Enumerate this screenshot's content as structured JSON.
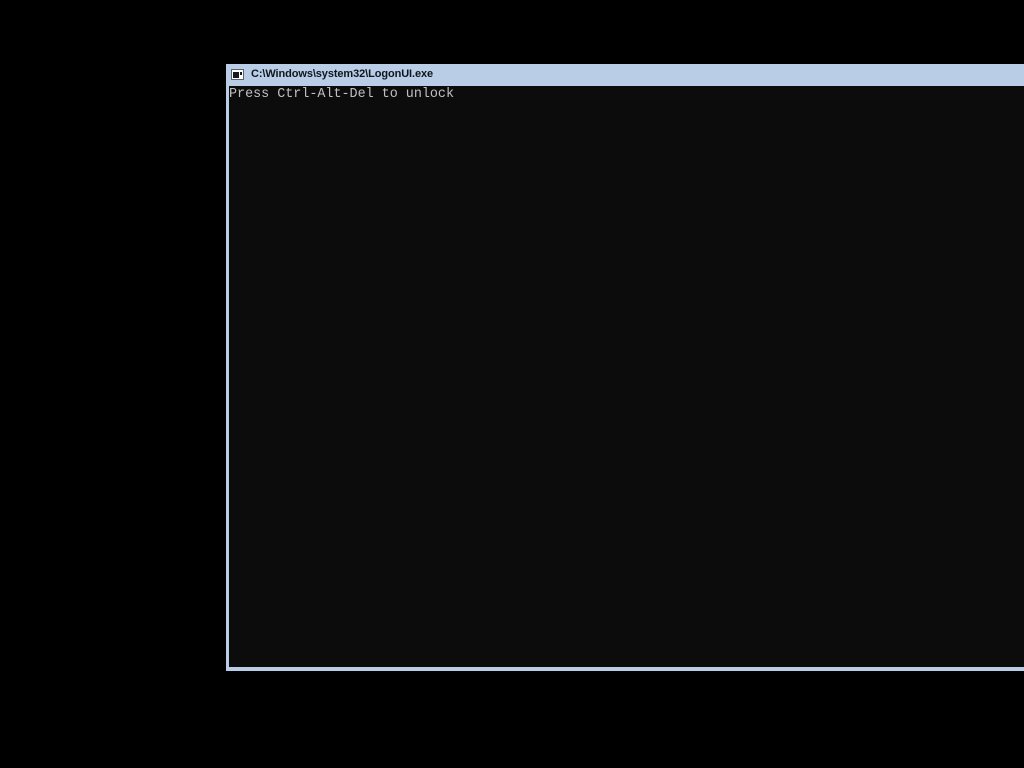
{
  "window": {
    "title": "C:\\Windows\\system32\\LogonUI.exe",
    "icon": "console-icon"
  },
  "console": {
    "output": "Press Ctrl-Alt-Del to unlock"
  },
  "colors": {
    "desktop_background": "#000000",
    "title_bar": "#b9cde6",
    "console_background": "#0c0c0c",
    "console_text": "#c0c0c0"
  }
}
